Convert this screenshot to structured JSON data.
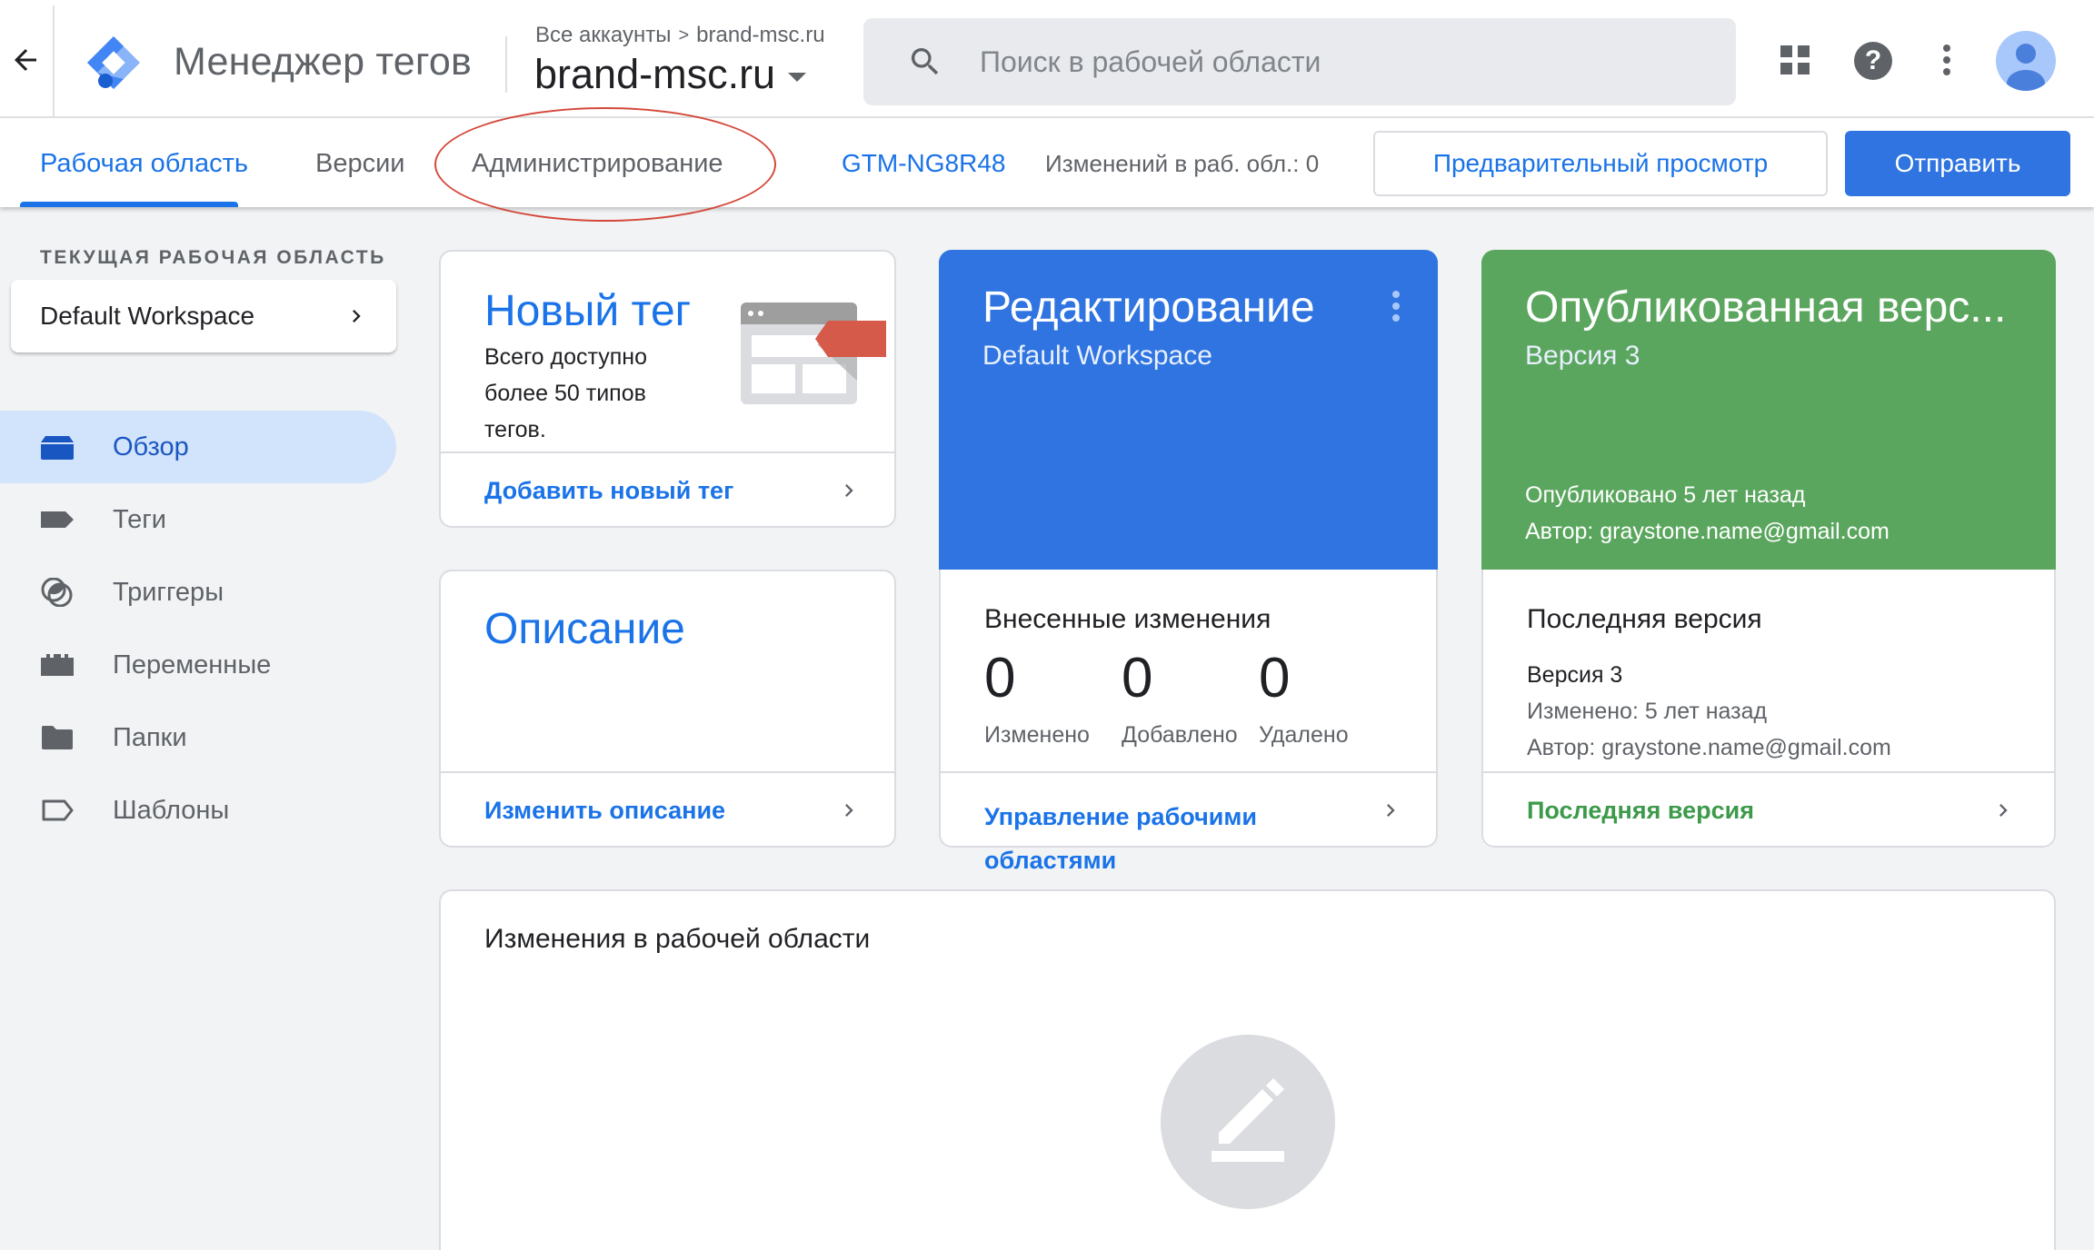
{
  "header": {
    "app_title": "Менеджер тегов",
    "breadcrumb": {
      "root": "Все аккаунты",
      "separator": ">",
      "account": "brand-msc.ru"
    },
    "container_name": "brand-msc.ru",
    "search": {
      "placeholder": "Поиск в рабочей области",
      "value": ""
    },
    "icons": [
      "back-arrow-icon",
      "apps-grid-icon",
      "help-icon",
      "more-vert-icon",
      "account-avatar"
    ]
  },
  "tabs": {
    "items": [
      {
        "label": "Рабочая область",
        "active": true
      },
      {
        "label": "Версии",
        "active": false
      },
      {
        "label": "Администрирование",
        "active": false,
        "annotated": true
      }
    ],
    "container_id": "GTM-NG8R48",
    "workspace_changes": "Изменений в раб. обл.: 0",
    "preview_label": "Предварительный просмотр",
    "submit_label": "Отправить"
  },
  "sidebar": {
    "workspace_heading": "ТЕКУЩАЯ РАБОЧАЯ ОБЛАСТЬ",
    "workspace_name": "Default Workspace",
    "items": [
      {
        "label": "Обзор",
        "icon": "overview-icon",
        "active": true
      },
      {
        "label": "Теги",
        "icon": "tag-icon",
        "active": false
      },
      {
        "label": "Триггеры",
        "icon": "trigger-icon",
        "active": false
      },
      {
        "label": "Переменные",
        "icon": "variables-icon",
        "active": false
      },
      {
        "label": "Папки",
        "icon": "folder-icon",
        "active": false
      },
      {
        "label": "Шаблоны",
        "icon": "template-icon",
        "active": false
      }
    ]
  },
  "cards": {
    "new_tag": {
      "title": "Новый тег",
      "description": "Всего доступно более 50 типов тегов.",
      "link": "Добавить новый тег"
    },
    "description": {
      "title": "Описание",
      "link": "Изменить описание"
    },
    "editing": {
      "title": "Редактирование",
      "subtitle": "Default Workspace",
      "changes_title": "Внесенные изменения",
      "stats": [
        {
          "value": "0",
          "label": "Изменено"
        },
        {
          "value": "0",
          "label": "Добавлено"
        },
        {
          "value": "0",
          "label": "Удалено"
        }
      ],
      "link": "Управление рабочими областями"
    },
    "published": {
      "title": "Опубликованная верс...",
      "subtitle": "Версия 3",
      "published_ago": "Опубликовано 5 лет назад",
      "author": "Автор: graystone.name@gmail.com",
      "latest_title": "Последняя версия",
      "latest_version": "Версия 3",
      "latest_modified": "Изменено: 5 лет назад",
      "latest_author": "Автор: graystone.name@gmail.com",
      "link": "Последняя версия"
    },
    "workspace_changes": {
      "title": "Изменения в рабочей области"
    }
  },
  "colors": {
    "accent_blue": "#1a73e8",
    "edit_card_blue": "#2f74e0",
    "published_green": "#5ba65e",
    "annotation_red": "#d4483a",
    "active_nav_bg": "#d2e3fc"
  }
}
